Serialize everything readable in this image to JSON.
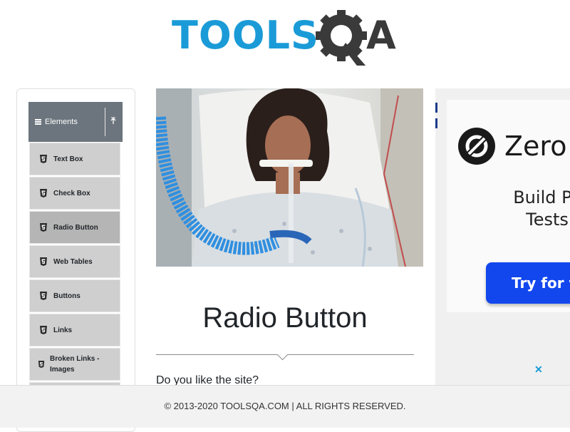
{
  "header": {
    "logo_text_tools": "TOOLS",
    "logo_text_a": "A"
  },
  "sidebar": {
    "group_title": "Elements",
    "items": [
      {
        "label": "Text Box",
        "active": false
      },
      {
        "label": "Check Box",
        "active": false
      },
      {
        "label": "Radio Button",
        "active": true
      },
      {
        "label": "Web Tables",
        "active": false
      },
      {
        "label": "Buttons",
        "active": false
      },
      {
        "label": "Links",
        "active": false
      },
      {
        "label": "Broken Links - Images",
        "active": false
      }
    ]
  },
  "main": {
    "title": "Radio Button",
    "question": "Do you like the site?"
  },
  "ad": {
    "brand": "Zero",
    "headline_line1": "Build Playw",
    "headline_line2": "Tests usi",
    "cta": "Try for fr",
    "close": "✕"
  },
  "footer": {
    "text": "© 2013-2020 TOOLSQA.COM | ALL RIGHTS RESERVED."
  },
  "colors": {
    "brand_blue": "#1a9bd7",
    "menu_header": "#6c757d",
    "menu_item": "#cfcfcf",
    "menu_item_active": "#b5b5b5",
    "ad_cta": "#1247ee"
  }
}
